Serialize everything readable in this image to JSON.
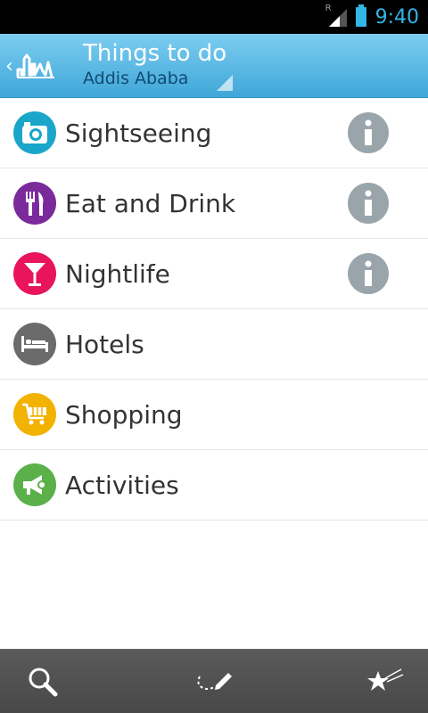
{
  "status_bar": {
    "time": "9:40",
    "roaming_indicator": "R",
    "signal_icon": "signal-icon",
    "battery_icon": "battery-icon",
    "accent_color": "#33b5e5"
  },
  "action_bar": {
    "title": "Things to do",
    "subtitle": "Addis Ababa",
    "up_icon": "chevron-left-icon",
    "logo_icon": "skyline-logo-icon"
  },
  "categories": [
    {
      "label": "Sightseeing",
      "icon": "camera-icon",
      "color": "#1aa6c8",
      "has_info": true
    },
    {
      "label": "Eat and Drink",
      "icon": "fork-knife-icon",
      "color": "#7b2a9c",
      "has_info": true
    },
    {
      "label": "Nightlife",
      "icon": "cocktail-icon",
      "color": "#e8145c",
      "has_info": true
    },
    {
      "label": "Hotels",
      "icon": "bed-icon",
      "color": "#6b6b6b",
      "has_info": false
    },
    {
      "label": "Shopping",
      "icon": "cart-icon",
      "color": "#f2b200",
      "has_info": false
    },
    {
      "label": "Activities",
      "icon": "megaphone-icon",
      "color": "#5bb04a",
      "has_info": false
    }
  ],
  "info_icon": "info-icon",
  "bottom_bar": {
    "buttons": [
      {
        "icon": "search-icon"
      },
      {
        "icon": "route-pencil-icon"
      },
      {
        "icon": "favorites-stars-icon"
      }
    ]
  }
}
